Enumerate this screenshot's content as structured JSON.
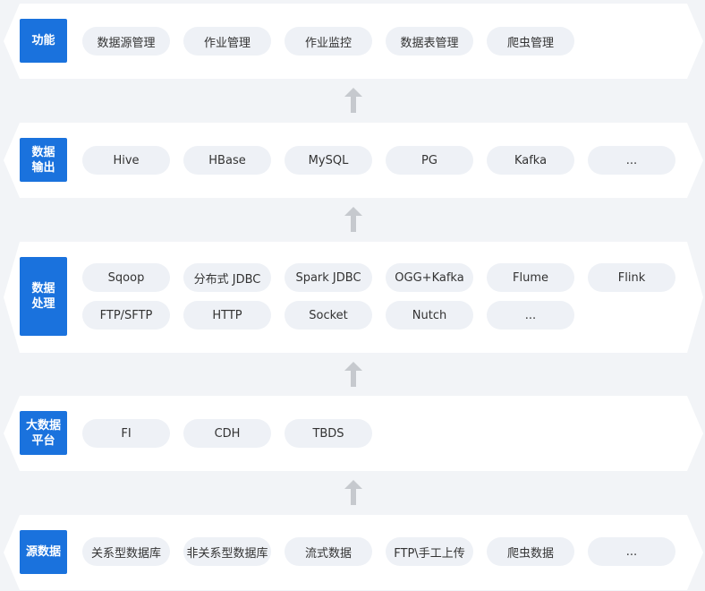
{
  "layers": [
    {
      "label": [
        "功能"
      ],
      "items": [
        "数据源管理",
        "作业管理",
        "作业监控",
        "数据表管理",
        "爬虫管理"
      ]
    },
    {
      "label": [
        "数据",
        "输出"
      ],
      "items": [
        "Hive",
        "HBase",
        "MySQL",
        "PG",
        "Kafka",
        "..."
      ]
    },
    {
      "label": [
        "数据",
        "处理"
      ],
      "items": [
        "Sqoop",
        "分布式 JDBC",
        "Spark JDBC",
        "OGG+Kafka",
        "Flume",
        "Flink",
        "FTP/SFTP",
        "HTTP",
        "Socket",
        "Nutch",
        "..."
      ]
    },
    {
      "label": [
        "大数据",
        "平台"
      ],
      "items": [
        "FI",
        "CDH",
        "TBDS"
      ]
    },
    {
      "label": [
        "源数据"
      ],
      "items": [
        "关系型数据库",
        "非关系型数据库",
        "流式数据",
        "FTP\\手工上传",
        "爬虫数据",
        "..."
      ]
    }
  ],
  "colors": {
    "tag": "#1a72dd",
    "pill": "#eef1f6",
    "arrow": "#c6c9ce",
    "background": "#f2f4f7"
  },
  "arrow_icon": "arrow-up-icon"
}
